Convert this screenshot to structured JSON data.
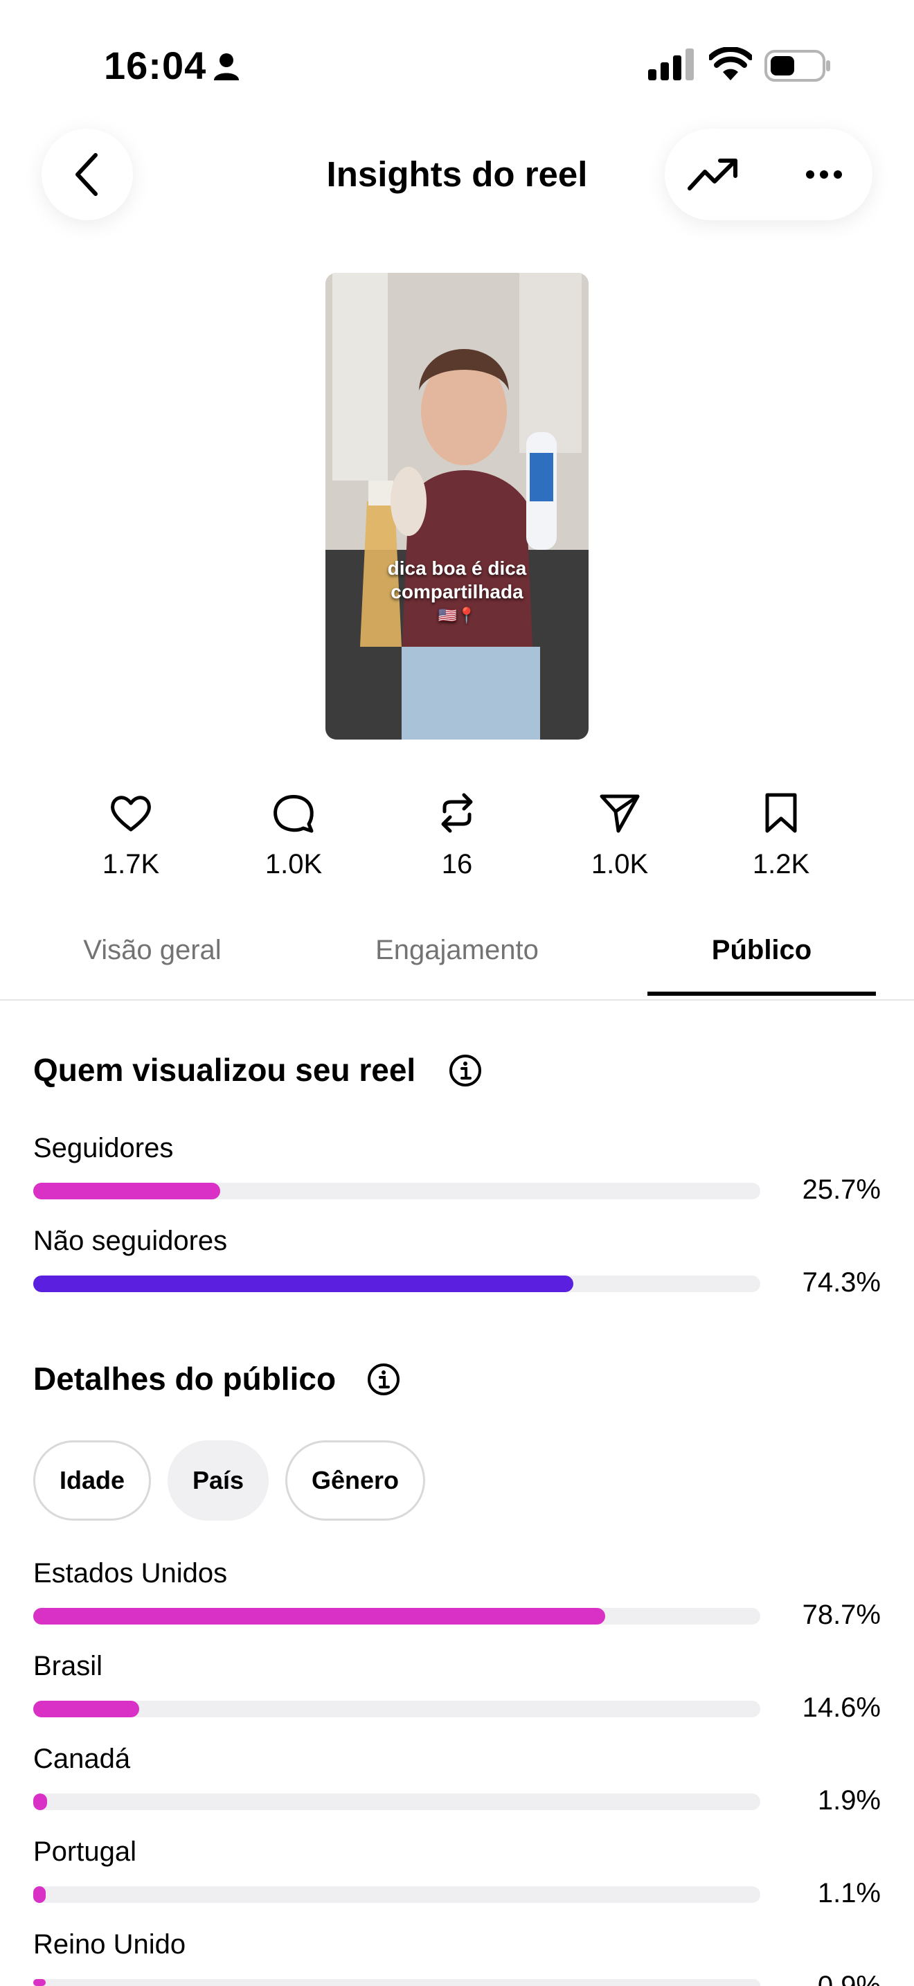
{
  "status_bar": {
    "time": "16:04"
  },
  "header": {
    "title": "Insights do reel"
  },
  "reel": {
    "caption_line1": "dica boa é dica",
    "caption_line2": "compartilhada",
    "caption_emoji": "🇺🇸📍"
  },
  "metrics": [
    {
      "icon": "heart-icon",
      "value": "1.7K"
    },
    {
      "icon": "comment-icon",
      "value": "1.0K"
    },
    {
      "icon": "repost-icon",
      "value": "16"
    },
    {
      "icon": "send-icon",
      "value": "1.0K"
    },
    {
      "icon": "bookmark-icon",
      "value": "1.2K"
    }
  ],
  "tabs": [
    {
      "label": "Visão geral",
      "active": false
    },
    {
      "label": "Engajamento",
      "active": false
    },
    {
      "label": "Público",
      "active": true
    }
  ],
  "viewers": {
    "title": "Quem visualizou seu reel",
    "rows": [
      {
        "label": "Seguidores",
        "percent": "25.7%",
        "fraction": 0.257,
        "color": "#d930c6"
      },
      {
        "label": "Não seguidores",
        "percent": "74.3%",
        "fraction": 0.743,
        "color": "#5b1fe0"
      }
    ]
  },
  "audience": {
    "title": "Detalhes do público",
    "chips": [
      {
        "label": "Idade",
        "active": false
      },
      {
        "label": "País",
        "active": true
      },
      {
        "label": "Gênero",
        "active": false
      }
    ],
    "rows": [
      {
        "label": "Estados Unidos",
        "percent": "78.7%",
        "fraction": 0.787
      },
      {
        "label": "Brasil",
        "percent": "14.6%",
        "fraction": 0.146
      },
      {
        "label": "Canadá",
        "percent": "1.9%",
        "fraction": 0.019
      },
      {
        "label": "Portugal",
        "percent": "1.1%",
        "fraction": 0.011
      },
      {
        "label": "Reino Unido",
        "percent": "0.9%",
        "fraction": 0.009
      }
    ],
    "bar_color": "#d930c6"
  }
}
